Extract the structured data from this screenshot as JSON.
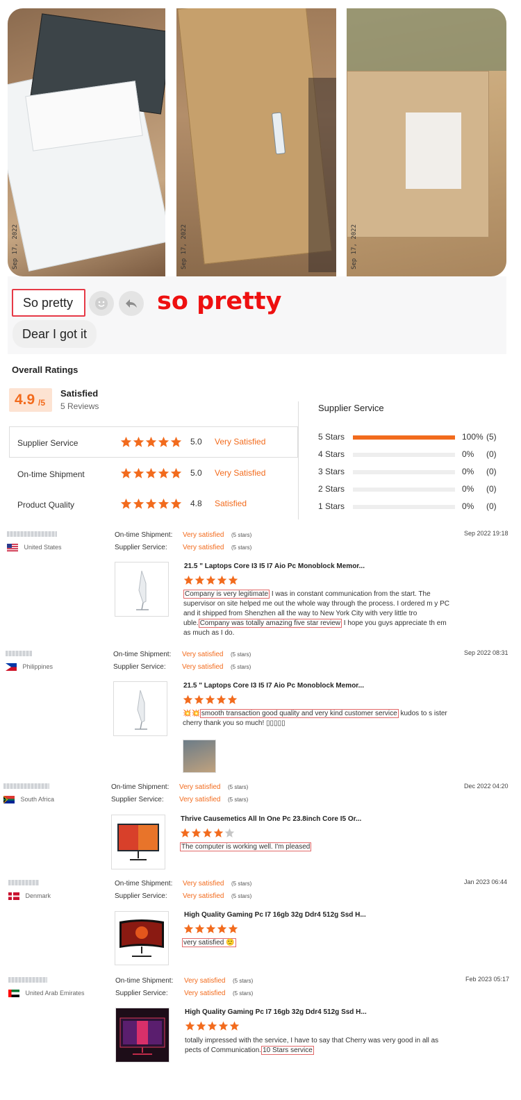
{
  "photos": {
    "stamps": [
      "Sep 17, 2022",
      "Sep 17, 2022",
      "Sep 17, 2022"
    ]
  },
  "chat": {
    "bubble_1": "So pretty",
    "bubble_2": "Dear I got it",
    "caption": "so pretty"
  },
  "ratings": {
    "title": "Overall Ratings",
    "score": "4.9",
    "score_max": "/5",
    "verdict": "Satisfied",
    "review_count": "5 Reviews",
    "rows": [
      {
        "label": "Supplier Service",
        "score": "5.0",
        "verdict": "Very Satisfied",
        "stars": 5
      },
      {
        "label": "On-time Shipment",
        "score": "5.0",
        "verdict": "Very Satisfied",
        "stars": 5
      },
      {
        "label": "Product Quality",
        "score": "4.8",
        "verdict": "Satisfied",
        "stars": 5
      }
    ],
    "distribution_title": "Supplier Service",
    "distribution": [
      {
        "label": "5 Stars",
        "percent": "100%",
        "count": "(5)",
        "fill": 1.0
      },
      {
        "label": "4 Stars",
        "percent": "0%",
        "count": "(0)",
        "fill": 0
      },
      {
        "label": "3 Stars",
        "percent": "0%",
        "count": "(0)",
        "fill": 0
      },
      {
        "label": "2 Stars",
        "percent": "0%",
        "count": "(0)",
        "fill": 0
      },
      {
        "label": "1 Stars",
        "percent": "0%",
        "count": "(0)",
        "fill": 0
      }
    ]
  },
  "labels": {
    "shipment": "On-time Shipment:",
    "supplier": "Supplier Service:",
    "very_satisfied": "Very satisfied",
    "five_stars": "(5 stars)"
  },
  "reviews": [
    {
      "country": "United States",
      "date": "Sep 2022 19:18",
      "product": "21.5 \" Laptops Core I3 I5 I7 Aio Pc Monoblock Memor...",
      "stars": 5,
      "text_hl1": "Company is very legitimate",
      "text_1": " I was in constant communication from the start. The supervisor on site helped me out the whole way through the process. I ordered m y PC and it shipped from Shenzhen all the way to New York City with very little tro uble.",
      "text_hl2": "Company was totally amazing five star review",
      "text_2": " I hope you guys appreciate th em as much as I do."
    },
    {
      "country": "Philippines",
      "date": "Sep 2022 08:31",
      "product": "21.5 \" Laptops Core I3 I5 I7 Aio Pc Monoblock Memor...",
      "stars": 5,
      "emoji": "💥💥",
      "text_hl1": "smooth transaction good quality and very kind customer service",
      "text_1": " kudos to s ister cherry thank you so much! ▯▯▯▯▯"
    },
    {
      "country": "South Africa",
      "date": "Dec 2022 04:20",
      "product": "Thrive Causemetics All In One Pc 23.8inch Core I5 Or...",
      "stars": 4,
      "text_hl1": "The computer is working well. I'm pleased"
    },
    {
      "country": "Denmark",
      "date": "Jan 2023 06:44",
      "product": "High Quality Gaming Pc I7 16gb 32g Ddr4 512g Ssd H...",
      "stars": 5,
      "text_hl1": "very satisfied 🙂"
    },
    {
      "country": "United Arab Emirates",
      "date": "Feb 2023 05:17",
      "product": "High Quality Gaming Pc I7 16gb 32g Ddr4 512g Ssd H...",
      "stars": 5,
      "text_1": "totally impressed with the service, I have to say that Cherry was very good in all as pects of Communication.",
      "text_hl1": "10 Stars service"
    }
  ],
  "colors": {
    "accent": "#f26b1d",
    "highlight": "#e26868",
    "caption_red": "#ee1010"
  }
}
